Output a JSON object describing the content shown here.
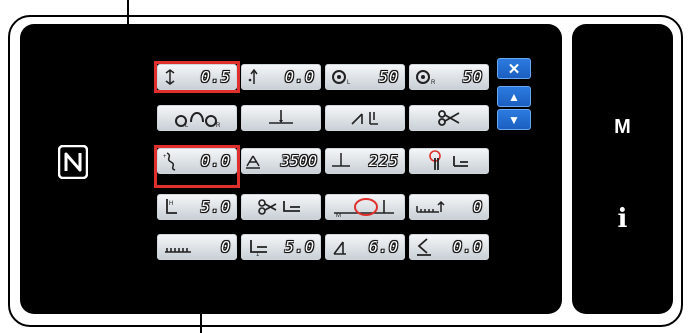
{
  "side_panel": {
    "mode_label": "M",
    "info_label": "i"
  },
  "nav": {
    "close_label": "✕",
    "up_label": "▲",
    "down_label": "▼"
  },
  "rows": [
    {
      "cells": [
        {
          "id": "thread-tension-adjust",
          "icon": "thread-tension-icon",
          "value": "0.5",
          "highlighted": true
        },
        {
          "id": "thread-tension-value",
          "icon": "needle-thread-icon",
          "value": "0.0"
        },
        {
          "id": "bobbin-left",
          "icon": "bobbin-left-icon",
          "value": "50"
        },
        {
          "id": "bobbin-right",
          "icon": "bobbin-right-icon",
          "value": "50"
        }
      ]
    },
    {
      "cells": [
        {
          "id": "bobbin-winder",
          "icon": "bobbin-winder-icon",
          "value": ""
        },
        {
          "id": "needle-position",
          "icon": "needle-position-icon",
          "value": ""
        },
        {
          "id": "presser-foot-lift",
          "icon": "presser-foot-lift-icon",
          "value": ""
        },
        {
          "id": "thread-trimmer",
          "icon": "scissors-icon",
          "value": ""
        }
      ]
    },
    {
      "cells": [
        {
          "id": "pitch-adjust",
          "icon": "pitch-icon",
          "value": "0.0",
          "highlighted": true
        },
        {
          "id": "max-speed",
          "icon": "speed-icon",
          "value": "3500"
        },
        {
          "id": "needle-drop",
          "icon": "needle-drop-icon",
          "value": "225"
        },
        {
          "id": "thread-trim-foot",
          "icon": "trim-foot-icon",
          "value": ""
        }
      ]
    },
    {
      "cells": [
        {
          "id": "foot-height",
          "icon": "foot-height-icon",
          "value": "5.0"
        },
        {
          "id": "trim-foot-up",
          "icon": "trim-foot-up-icon",
          "value": ""
        },
        {
          "id": "needle-stop-manual",
          "icon": "needle-stop-icon",
          "value": ""
        },
        {
          "id": "foot-pressure",
          "icon": "foot-pressure-icon",
          "value": "0"
        }
      ]
    },
    {
      "cells": [
        {
          "id": "stitch-count",
          "icon": "stitch-count-icon",
          "value": "0"
        },
        {
          "id": "foot-lift-amount",
          "icon": "foot-lift-amount-icon",
          "value": "5.0"
        },
        {
          "id": "knee-lift",
          "icon": "knee-lift-icon",
          "value": "6.0"
        },
        {
          "id": "reverse-feed",
          "icon": "reverse-feed-icon",
          "value": "0.0"
        }
      ]
    }
  ],
  "colors": {
    "highlight": "#e0302e",
    "nav_blue": "#1b5fc0",
    "screen": "#000000"
  }
}
